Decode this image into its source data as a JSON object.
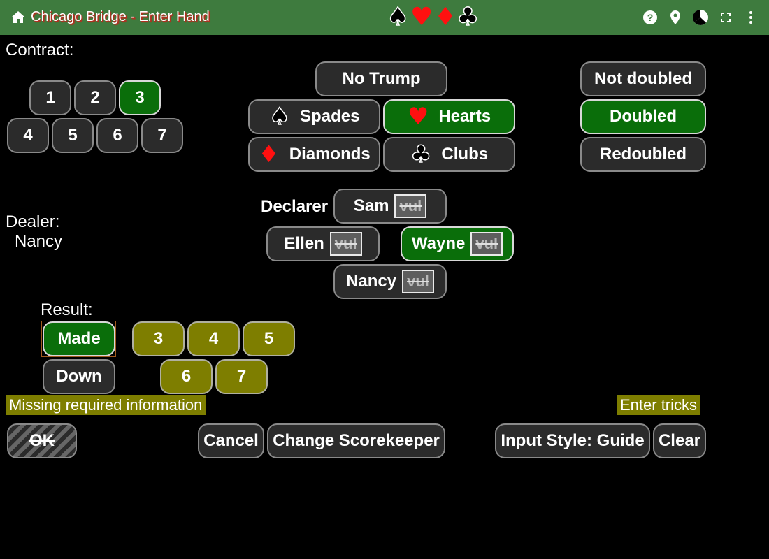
{
  "topbar": {
    "title": "Chicago Bridge - Enter Hand",
    "home_icon": "home-icon",
    "suits": [
      "♠",
      "♥",
      "♦",
      "♣"
    ],
    "icons": [
      "help-icon",
      "location-icon",
      "pie-chart-icon",
      "fullscreen-icon",
      "more-vert-icon"
    ]
  },
  "contract": {
    "label": "Contract:",
    "levels": [
      "1",
      "2",
      "3",
      "4",
      "5",
      "6",
      "7"
    ],
    "selected_level": "3",
    "strains": {
      "no_trump": "No Trump",
      "spades": "Spades",
      "hearts": "Hearts",
      "diamonds": "Diamonds",
      "clubs": "Clubs"
    },
    "selected_strain": "Hearts",
    "doubling": [
      "Not doubled",
      "Doubled",
      "Redoubled"
    ],
    "selected_doubling": "Doubled"
  },
  "declarer": {
    "label": "Declarer",
    "players": [
      "Sam",
      "Ellen",
      "Wayne",
      "Nancy"
    ],
    "vul_label": "vul",
    "selected": "Wayne"
  },
  "dealer": {
    "label": "Dealer:",
    "name": "Nancy"
  },
  "result": {
    "label": "Result:",
    "made": "Made",
    "down": "Down",
    "selected": "Made",
    "tricks": [
      "3",
      "4",
      "5",
      "6",
      "7"
    ]
  },
  "status": {
    "left": "Missing required information",
    "right": "Enter tricks"
  },
  "actions": {
    "ok": "OK",
    "cancel": "Cancel",
    "change_scorekeeper": "Change Scorekeeper",
    "input_style": "Input Style: Guide",
    "clear": "Clear"
  },
  "colors": {
    "topbar": "#3e7b3e",
    "selected": "#0a6e0a",
    "olive": "#7e7e00",
    "button": "#2b2b2b"
  }
}
